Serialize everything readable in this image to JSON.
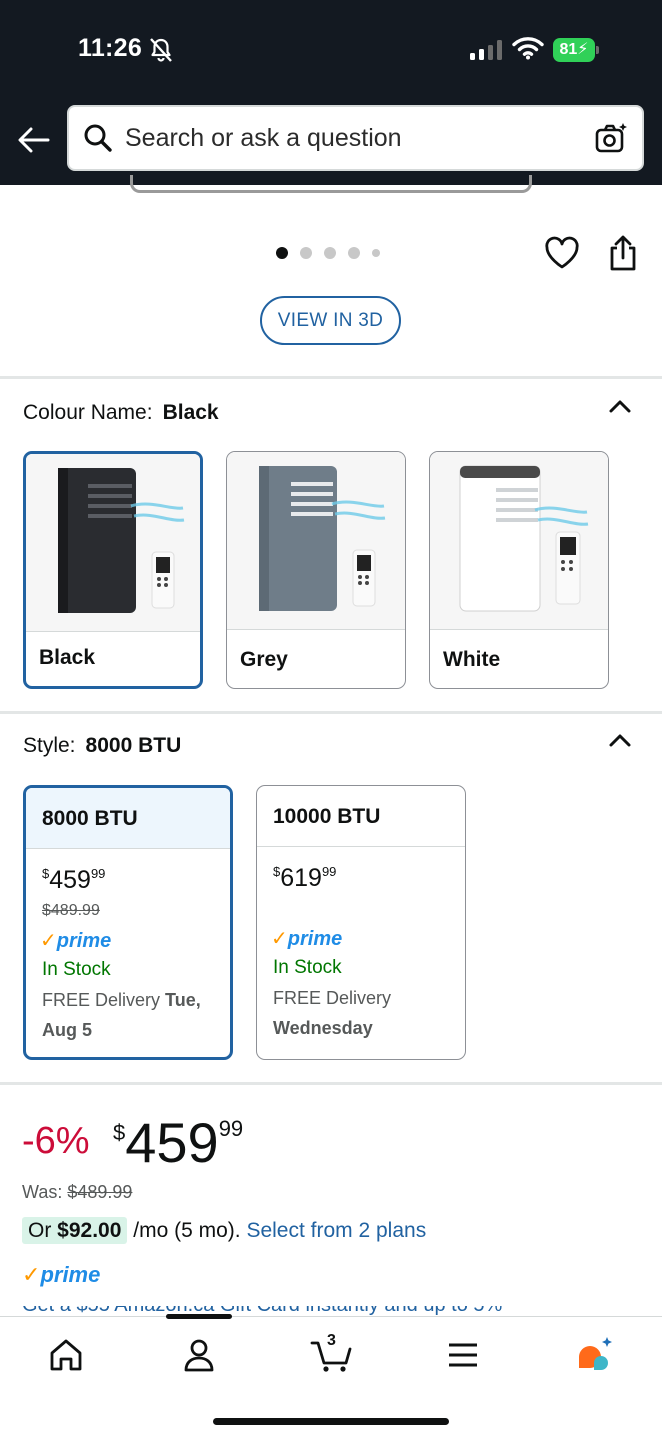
{
  "status_bar": {
    "time": "11:26",
    "battery": "81"
  },
  "search": {
    "placeholder": "Search or ask a question"
  },
  "gallery": {
    "dot_count": 5,
    "active_dot": 0,
    "view_3d_label": "VIEW IN 3D"
  },
  "colour": {
    "label": "Colour Name:",
    "selected": "Black",
    "options": [
      {
        "label": "Black",
        "selected": true
      },
      {
        "label": "Grey",
        "selected": false
      },
      {
        "label": "White",
        "selected": false
      }
    ]
  },
  "style": {
    "label": "Style:",
    "selected": "8000 BTU",
    "options": [
      {
        "label": "8000 BTU",
        "price_whole": "459",
        "price_fraction": "99",
        "currency": "$",
        "was": "$489.99",
        "prime": "prime",
        "stock": "In Stock",
        "delivery_prefix": "FREE Delivery",
        "delivery_date": "Tue, Aug 5",
        "selected": true
      },
      {
        "label": "10000 BTU",
        "price_whole": "619",
        "price_fraction": "99",
        "currency": "$",
        "was": "",
        "prime": "prime",
        "stock": "In Stock",
        "delivery_prefix": "FREE Delivery",
        "delivery_date": "Wednesday",
        "selected": false
      }
    ]
  },
  "price": {
    "discount": "-6%",
    "currency": "$",
    "whole": "459",
    "fraction": "99",
    "was_label": "Was:",
    "was_value": "$489.99",
    "plan_prefix": "Or",
    "plan_amount": "$92.00",
    "plan_terms": "/mo (5 mo).",
    "plan_link": "Select from 2 plans",
    "prime": "prime",
    "partial_text": "Get a $55 Amazon.ca Gift Card instantly and up to 5%"
  },
  "bottom_nav": {
    "cart_count": "3",
    "items": [
      "home",
      "account",
      "cart",
      "menu",
      "rufus"
    ]
  },
  "colors": {
    "header_bg": "#131921",
    "accent_blue": "#2162a1",
    "prime_blue": "#1f8ce6",
    "discount_red": "#cc0c39",
    "stock_green": "#007600",
    "selected_border": "#2162a1"
  }
}
